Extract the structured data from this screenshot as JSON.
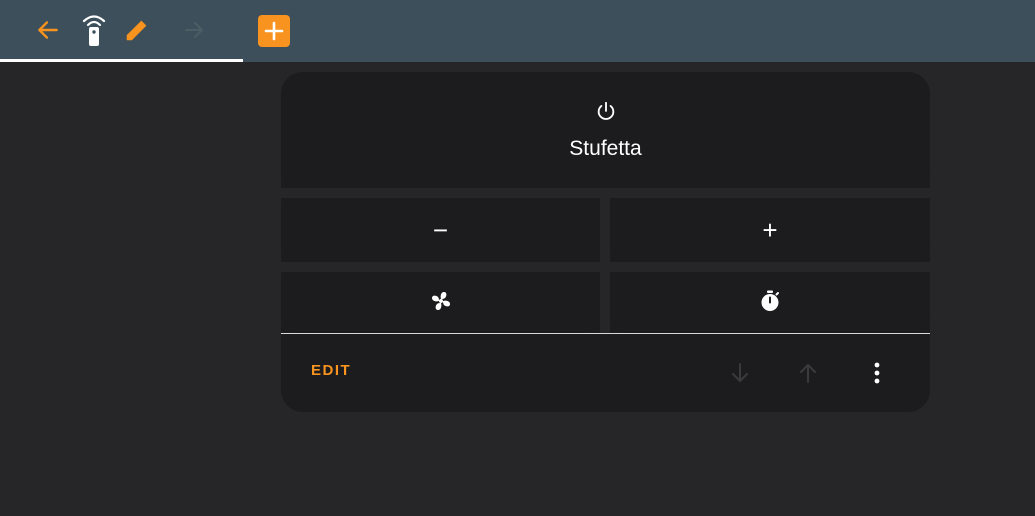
{
  "toolbar": {
    "icons": [
      "back-arrow-icon",
      "remote-icon",
      "pencil-icon",
      "forward-arrow-icon"
    ],
    "add_icon": "plus-square-icon"
  },
  "card": {
    "main_tile": {
      "icon": "power-icon",
      "label": "Stufetta"
    },
    "minus_label": "−",
    "plus_label": "+",
    "fan_icon": "fan-icon",
    "timer_icon": "timer-icon",
    "footer": {
      "edit_label": "EDIT",
      "move_down_icon": "arrow-down-icon",
      "move_up_icon": "arrow-up-icon",
      "more_icon": "more-vertical-icon"
    }
  },
  "colors": {
    "accent": "#f7931e",
    "topbar": "#3c4f5a",
    "background": "#262628",
    "card": "#1c1c1e",
    "disabled": "#3a3a3c"
  }
}
